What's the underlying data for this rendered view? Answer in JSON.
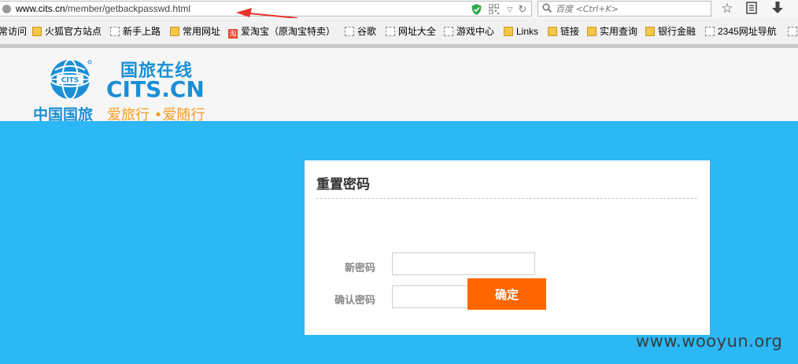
{
  "browser": {
    "url_host": "www.cits.cn",
    "url_path": "/member/getbackpasswd.html",
    "search_placeholder": "百度 <Ctrl+K>",
    "icons": {
      "page": "globe-icon",
      "shield": "shield-icon",
      "qr": "qr-code-icon",
      "dropdown": "chevron-down-icon",
      "reload": "reload-icon",
      "search": "search-icon",
      "bookmark_star": "star-icon",
      "reading_list": "reading-list-icon",
      "download": "download-icon"
    },
    "annotation_color": "#e8332b"
  },
  "bookmarks": [
    {
      "label": "常访问",
      "icon": "none"
    },
    {
      "label": "火狐官方站点",
      "icon": "folder"
    },
    {
      "label": "新手上路",
      "icon": "dashed"
    },
    {
      "label": "常用网址",
      "icon": "folder"
    },
    {
      "label": "爱淘宝（原淘宝特卖）",
      "icon": "taobao"
    },
    {
      "label": "谷歌",
      "icon": "dashed"
    },
    {
      "label": "网址大全",
      "icon": "dashed"
    },
    {
      "label": "游戏中心",
      "icon": "dashed"
    },
    {
      "label": "Links",
      "icon": "folder"
    },
    {
      "label": "链接",
      "icon": "folder"
    },
    {
      "label": "实用查询",
      "icon": "folder"
    },
    {
      "label": "银行金融",
      "icon": "folder"
    },
    {
      "label": "2345网址导航",
      "icon": "dashed"
    }
  ],
  "header": {
    "logo_line1": "国旅在线",
    "logo_line2": "CITS.CN",
    "logo_line3": "中国国旅",
    "logo_slogan": "爱旅行 •爱随行",
    "emblem_text": "CITS",
    "brand_blue": "#1a8fd6",
    "brand_orange": "#f39c1e"
  },
  "form": {
    "title": "重置密码",
    "new_password_label": "新密码",
    "confirm_password_label": "确认密码",
    "new_password_value": "",
    "confirm_password_value": "",
    "submit_label": "确定",
    "background_color": "#2cb7f5",
    "button_color": "#ff6600"
  },
  "watermark": "www.wooyun.org"
}
